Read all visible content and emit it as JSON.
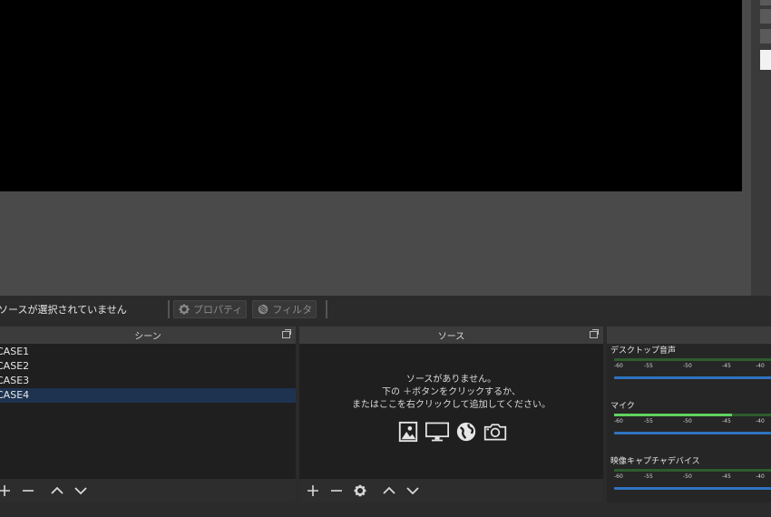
{
  "source_toolbar": {
    "no_source_text": "ソースが選択されていません",
    "properties_label": "プロパティ",
    "filters_label": "フィルタ"
  },
  "scenes": {
    "title": "シーン",
    "items": [
      "CASE1",
      "CASE2",
      "CASE3",
      "CASE4"
    ],
    "selected_index": 3
  },
  "sources": {
    "title": "ソース",
    "empty_line1": "ソースがありません。",
    "empty_line2": "下の ＋ボタンをクリックするか、",
    "empty_line3": "またはここを右クリックして追加してください。",
    "icons": [
      "image-icon",
      "display-icon",
      "globe-icon",
      "camera-icon"
    ]
  },
  "mixer": {
    "channels": [
      {
        "name": "デスクトップ音声",
        "level": 0.0
      },
      {
        "name": "マイク",
        "level": 0.75
      },
      {
        "name": "映像キャプチャデバイス",
        "level": 0.0
      }
    ],
    "scale": [
      "-60",
      "-55",
      "-50",
      "-45",
      "-40"
    ]
  },
  "colors": {
    "selection": "#1e3350",
    "meter_green": "#5fd35f",
    "fader_blue": "#2f74c0"
  }
}
